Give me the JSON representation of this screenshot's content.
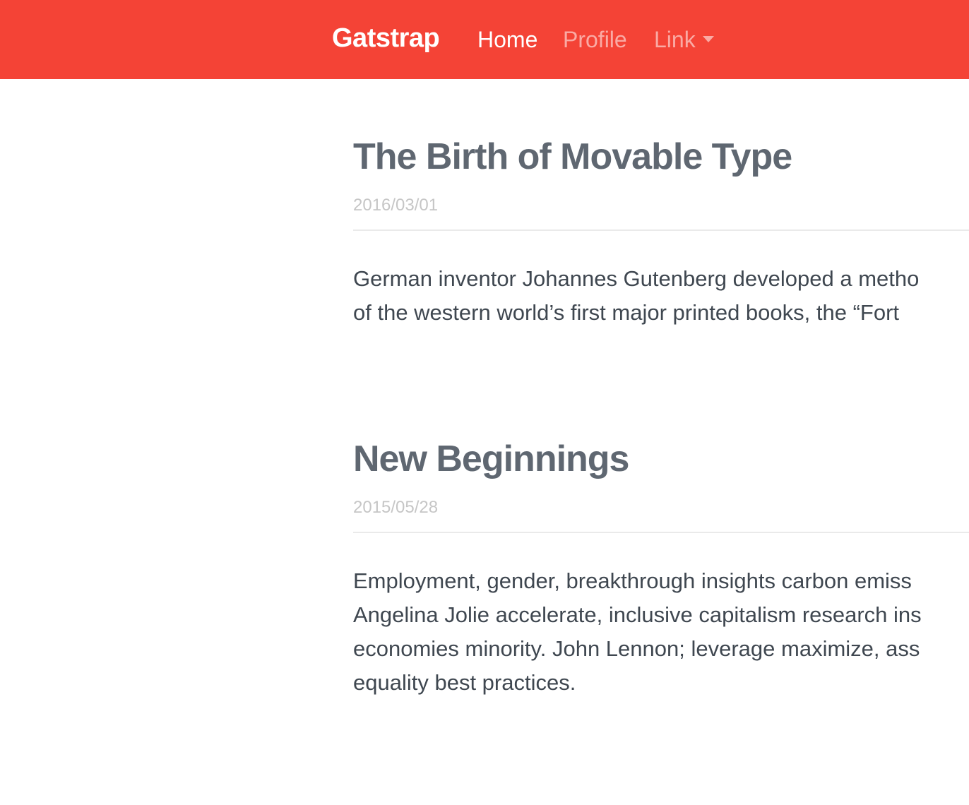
{
  "navbar": {
    "brand": "Gatstrap",
    "items": [
      {
        "label": "Home",
        "active": true
      },
      {
        "label": "Profile",
        "active": false
      },
      {
        "label": "Link",
        "active": false,
        "dropdown": true
      }
    ]
  },
  "posts": [
    {
      "title": "The Birth of Movable Type",
      "date": "2016/03/01",
      "excerpt_lines": [
        "German inventor Johannes Gutenberg developed a metho",
        "of the western world’s first major printed books, the “Fort"
      ]
    },
    {
      "title": "New Beginnings",
      "date": "2015/05/28",
      "excerpt_lines": [
        "Employment, gender, breakthrough insights carbon emiss",
        "Angelina Jolie accelerate, inclusive capitalism research ins",
        "economies minority. John Lennon; leverage maximize, ass",
        "equality best practices."
      ]
    }
  ],
  "colors": {
    "navbar_bg": "#f44336",
    "title": "#5f6771",
    "date": "#c6c6c6",
    "body_text": "#3f4750"
  },
  "icons": {
    "dropdown": "caret-down-icon"
  }
}
